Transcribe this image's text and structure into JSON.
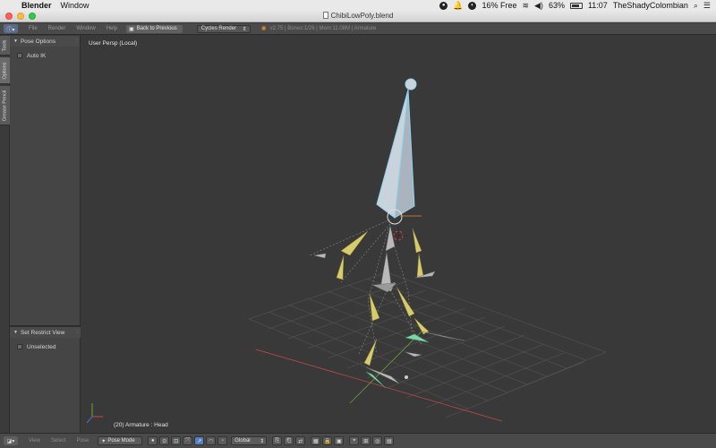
{
  "menubar": {
    "app_name": "Blender",
    "window_menu": "Window",
    "battery_text": "16% Free",
    "battery_percent": "63%",
    "clock": "11:07",
    "user": "TheShadyColombian"
  },
  "window": {
    "title": "ChibiLowPoly.blend"
  },
  "info_header": {
    "menus": [
      "File",
      "Render",
      "Window",
      "Help"
    ],
    "back_button": "Back to Previous",
    "render_engine": "Cycles Render",
    "stats": "v2.75 | Bones:1/26 | Mem:11.08M | Armature"
  },
  "tool_tabs": [
    "Tools",
    "Options",
    "Grease Pencil"
  ],
  "tool_shelf": {
    "pose_options": {
      "title": "Pose Options",
      "auto_ik": "Auto IK"
    },
    "restrict_view": {
      "title": "Set Restrict View",
      "unselected": "Unselected"
    }
  },
  "viewport": {
    "view_label": "User Persp (Local)",
    "object_label": "(20) Armature : Head"
  },
  "view3d_header": {
    "menus": [
      "View",
      "Select",
      "Pose"
    ],
    "mode": "Pose Mode",
    "orientation": "Global"
  },
  "colors": {
    "bone_selected": "#c9d3dc",
    "bone_outline_selected": "#8fd4f0",
    "bone_ik": "#d8cb6a",
    "bone_default": "#b9b9b9",
    "grid": "#4f4f4f",
    "axis_x": "#c24a4a",
    "axis_y": "#6aa52f"
  }
}
